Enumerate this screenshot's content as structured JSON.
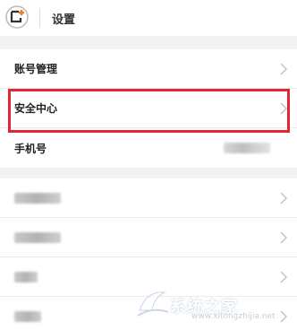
{
  "header": {
    "title": "设置"
  },
  "section1": {
    "items": [
      {
        "label": "账号管理"
      },
      {
        "label": "安全中心"
      },
      {
        "label": "手机号"
      }
    ]
  },
  "watermark": {
    "text": "系统之家",
    "url": "www.xitongzhijia.net"
  },
  "colors": {
    "highlight": "#e02832",
    "background": "#f2f2f2",
    "back_icon_accent": "#f07b1f"
  }
}
